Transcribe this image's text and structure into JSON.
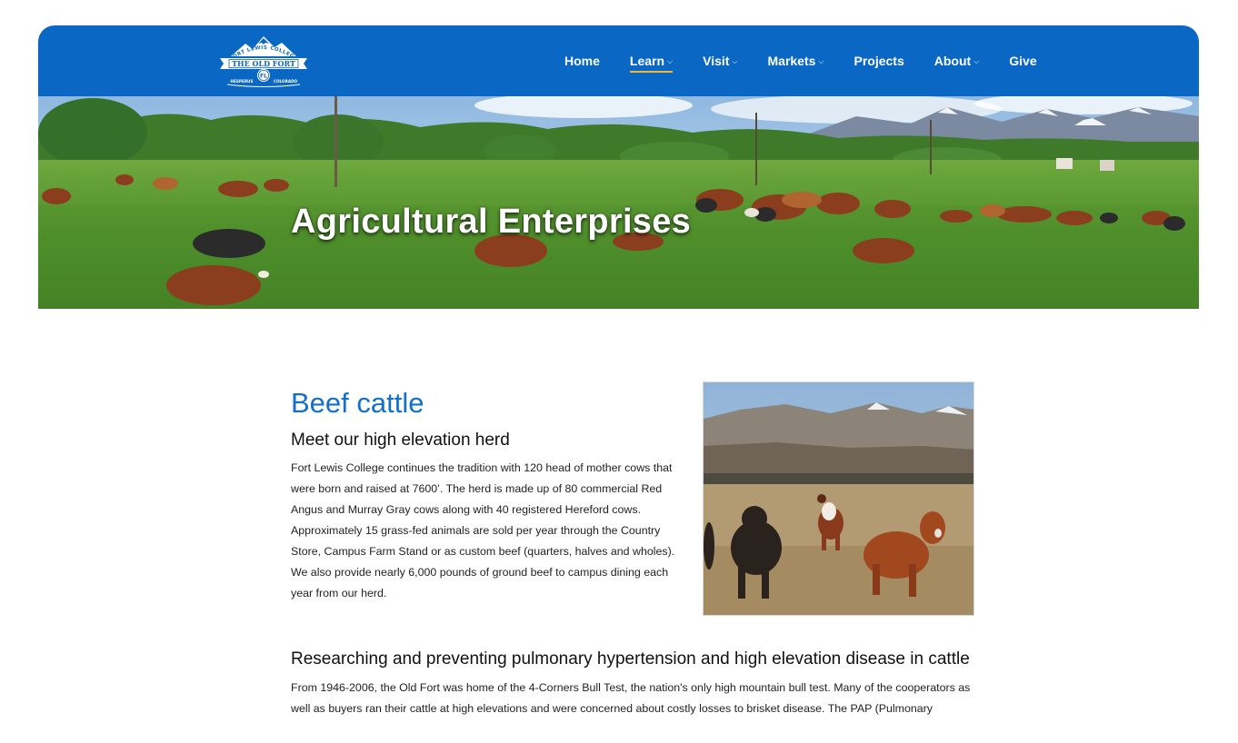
{
  "brand": {
    "logo_top_text": "FORT LEWIS COLLEGE",
    "logo_main_text": "THE OLD FORT",
    "logo_monogram": "FL",
    "logo_left_text": "HESPERUS",
    "logo_right_text": "COLORADO"
  },
  "nav": {
    "items": [
      {
        "label": "Home",
        "dropdown": false,
        "active": false
      },
      {
        "label": "Learn",
        "dropdown": true,
        "active": true
      },
      {
        "label": "Visit",
        "dropdown": true,
        "active": false
      },
      {
        "label": "Markets",
        "dropdown": true,
        "active": false
      },
      {
        "label": "Projects",
        "dropdown": false,
        "active": false
      },
      {
        "label": "About",
        "dropdown": true,
        "active": false
      },
      {
        "label": "Give",
        "dropdown": false,
        "active": false
      }
    ],
    "caret": "⌵"
  },
  "hero": {
    "title": "Agricultural Enterprises"
  },
  "section": {
    "title": "Beef cattle",
    "subheading": "Meet our high elevation herd",
    "paragraph": "Fort Lewis College continues the tradition with 120 head of mother cows that were born and raised at 7600’. The herd is made up of 80 commercial Red Angus and Murray Gray cows along with 40 registered Hereford cows. Approximately 15 grass-fed animals are sold per year through the Country Store, Campus Farm Stand or as custom beef (quarters, halves and wholes). We also provide nearly 6,000 pounds of ground beef to campus dining each year from our herd.",
    "subheading2": "Researching and preventing pulmonary hypertension and high elevation disease in cattle",
    "paragraph2": "From 1946-2006, the Old Fort was home of the 4-Corners Bull Test, the nation's only high mountain bull test. Many of the cooperators as well as buyers ran their cattle at high elevations and were concerned about costly losses to brisket disease. The PAP (Pulmonary"
  },
  "colors": {
    "header_blue": "#0a67c4",
    "title_blue": "#1370c7",
    "active_underline": "#f2b632"
  }
}
